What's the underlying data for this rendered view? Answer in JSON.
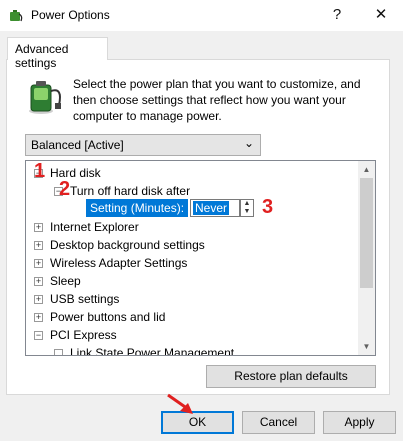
{
  "window": {
    "title": "Power Options",
    "help_label": "?",
    "close_label": "✕"
  },
  "tabs": [
    {
      "label": "Advanced settings"
    }
  ],
  "description": "Select the power plan that you want to customize, and then choose settings that reflect how you want your computer to manage power.",
  "plan_dropdown": {
    "value": "Balanced [Active]"
  },
  "tree": {
    "items": [
      {
        "label": "Hard disk",
        "expander": "−"
      },
      {
        "label": "Turn off hard disk after",
        "expander": "−"
      },
      {
        "label": "Internet Explorer",
        "expander": "+"
      },
      {
        "label": "Desktop background settings",
        "expander": "+"
      },
      {
        "label": "Wireless Adapter Settings",
        "expander": "+"
      },
      {
        "label": "Sleep",
        "expander": "+"
      },
      {
        "label": "USB settings",
        "expander": "+"
      },
      {
        "label": "Power buttons and lid",
        "expander": "+"
      },
      {
        "label": "PCI Express",
        "expander": "−"
      },
      {
        "label": "Link State Power Management",
        "expander": ""
      }
    ],
    "setting": {
      "label": "Setting (Minutes):",
      "value": "Never"
    }
  },
  "annotations": {
    "one": "1",
    "two": "2",
    "three": "3"
  },
  "buttons": {
    "restore": "Restore plan defaults",
    "ok": "OK",
    "cancel": "Cancel",
    "apply": "Apply"
  },
  "colors": {
    "selection": "#0078d7",
    "annotation": "#e02020"
  }
}
